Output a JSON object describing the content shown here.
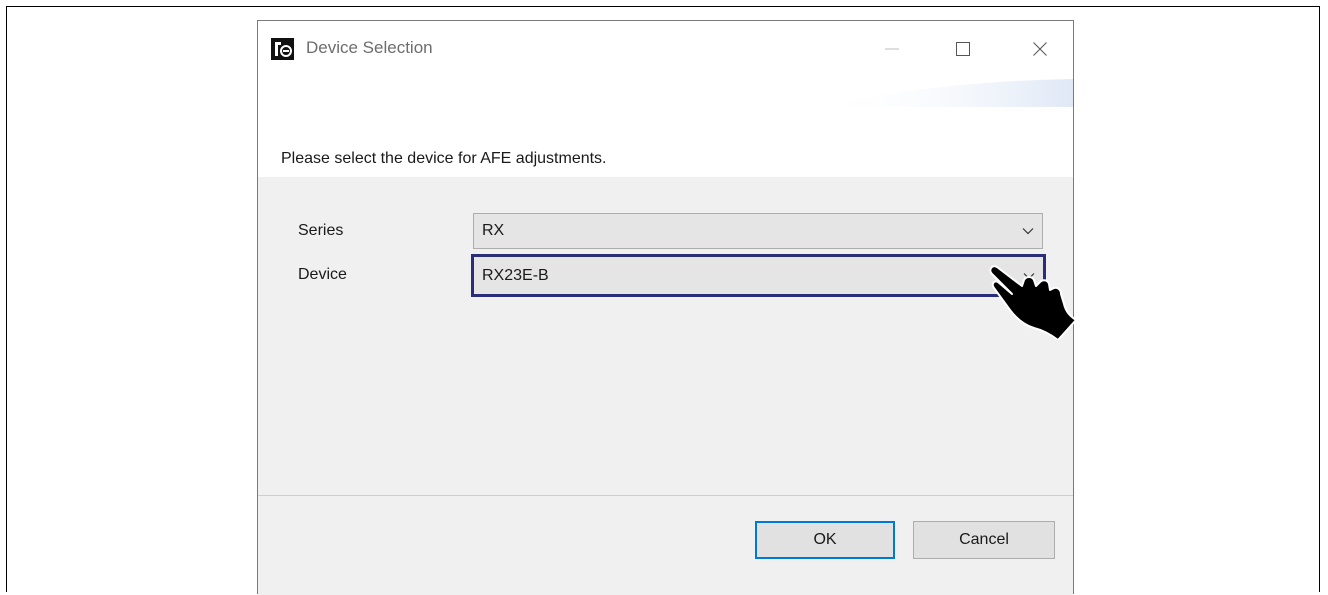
{
  "window": {
    "title": "Device Selection",
    "minimize_glyph": "—",
    "maximize_glyph": "☐",
    "close_glyph": "✕"
  },
  "instruction": "Please select the device for AFE adjustments.",
  "fields": {
    "series": {
      "label": "Series",
      "value": "RX"
    },
    "device": {
      "label": "Device",
      "value": "RX23E-B"
    }
  },
  "buttons": {
    "ok": "OK",
    "cancel": "Cancel"
  },
  "icons": {
    "app": "renesas-app-icon",
    "dropdown": "chevron-down-icon",
    "pointer": "hand-pointer-icon"
  },
  "colors": {
    "focus_border": "#2a2d78",
    "ok_border": "#0078d7",
    "content_bg": "#f0f0f0"
  }
}
